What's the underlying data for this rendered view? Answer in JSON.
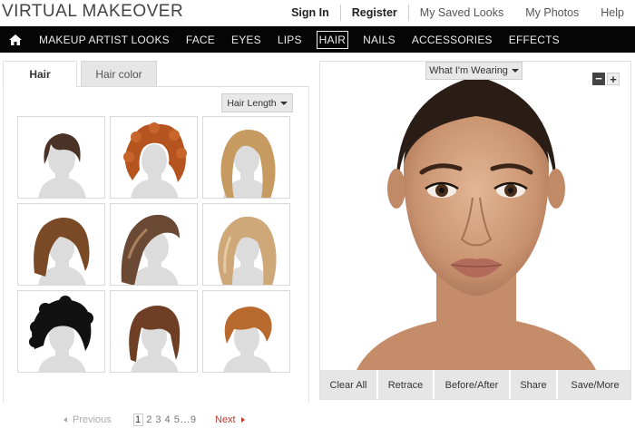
{
  "app": {
    "title": "VIRTUAL MAKEOVER"
  },
  "top_links": [
    {
      "label": "Sign In"
    },
    {
      "label": "Register"
    },
    {
      "label": "My Saved Looks"
    },
    {
      "label": "My Photos"
    },
    {
      "label": "Help"
    }
  ],
  "nav": {
    "home_icon": "home-icon",
    "items": [
      {
        "label": "MAKEUP ARTIST LOOKS"
      },
      {
        "label": "FACE"
      },
      {
        "label": "EYES"
      },
      {
        "label": "LIPS"
      },
      {
        "label": "HAIR",
        "active": true
      },
      {
        "label": "NAILS"
      },
      {
        "label": "ACCESSORIES"
      },
      {
        "label": "EFFECTS"
      }
    ]
  },
  "left_panel": {
    "tabs": [
      {
        "label": "Hair",
        "active": true
      },
      {
        "label": "Hair color"
      }
    ],
    "filter_dropdown": {
      "label": "Hair Length"
    },
    "hairstyles": [
      {
        "style": "short-brown-bob",
        "color": "#4a3326"
      },
      {
        "style": "curly-auburn",
        "color": "#b5541f"
      },
      {
        "style": "long-wavy-blonde",
        "color": "#c79a62"
      },
      {
        "style": "medium-brown-bob",
        "color": "#7a4a27"
      },
      {
        "style": "side-swept-highlights",
        "color": "#6b4a35"
      },
      {
        "style": "long-blonde-waves",
        "color": "#cfa87a"
      },
      {
        "style": "short-curly-black",
        "color": "#111111"
      },
      {
        "style": "brown-bob-bangs",
        "color": "#6e3f24"
      },
      {
        "style": "short-copper-pixie",
        "color": "#b86a2e"
      }
    ],
    "pagination": {
      "previous": "Previous",
      "current": "1",
      "pages": "2 3 4 5…9",
      "next": "Next"
    }
  },
  "right_panel": {
    "wearing_dropdown": {
      "label": "What I'm Wearing"
    },
    "zoom": {
      "minus": "−",
      "plus": "+"
    },
    "actions": [
      {
        "label": "Clear All"
      },
      {
        "label": "Retrace"
      },
      {
        "label": "Before/After"
      },
      {
        "label": "Share"
      },
      {
        "label": "Save/More"
      }
    ]
  },
  "colors": {
    "nav_bg": "#050505",
    "accent_red": "#c0392b",
    "button_gray": "#e6e6e6"
  }
}
